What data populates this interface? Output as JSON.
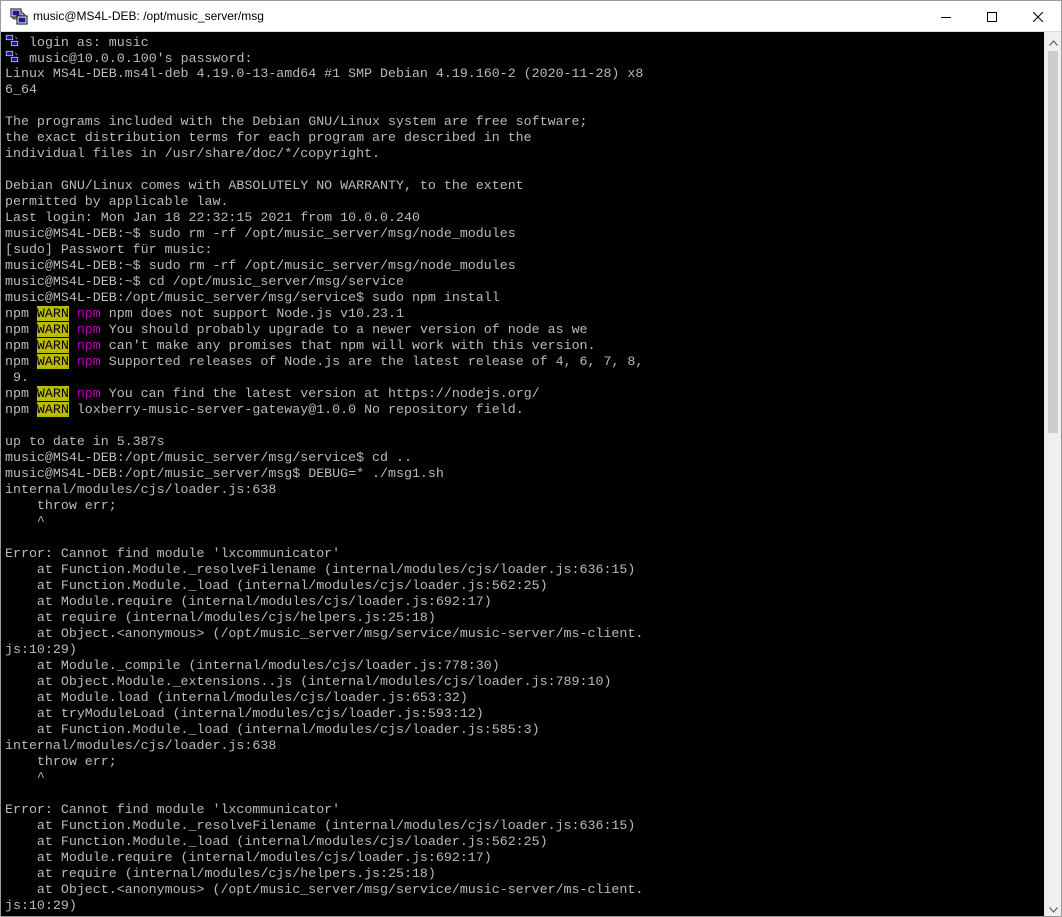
{
  "window": {
    "title": "music@MS4L-DEB: /opt/music_server/msg",
    "icons": {
      "app": "putty-icon",
      "minimize": "minimize-icon",
      "maximize": "maximize-icon",
      "close": "close-icon",
      "key": "key-icon"
    }
  },
  "colors": {
    "background": "#000000",
    "foreground": "#bbbbbb",
    "warn_bg": "#bbbb00",
    "npm_magenta": "#bb00bb"
  },
  "terminal": {
    "lines": [
      {
        "icon": "key",
        "segments": [
          {
            "text": "login as: music"
          }
        ]
      },
      {
        "icon": "key",
        "segments": [
          {
            "text": "music@10.0.0.100's password:"
          }
        ]
      },
      {
        "segments": [
          {
            "text": "Linux MS4L-DEB.ms4l-deb 4.19.0-13-amd64 #1 SMP Debian 4.19.160-2 (2020-11-28) x8"
          }
        ]
      },
      {
        "segments": [
          {
            "text": "6_64"
          }
        ]
      },
      {
        "segments": [
          {
            "text": ""
          }
        ]
      },
      {
        "segments": [
          {
            "text": "The programs included with the Debian GNU/Linux system are free software;"
          }
        ]
      },
      {
        "segments": [
          {
            "text": "the exact distribution terms for each program are described in the"
          }
        ]
      },
      {
        "segments": [
          {
            "text": "individual files in /usr/share/doc/*/copyright."
          }
        ]
      },
      {
        "segments": [
          {
            "text": ""
          }
        ]
      },
      {
        "segments": [
          {
            "text": "Debian GNU/Linux comes with ABSOLUTELY NO WARRANTY, to the extent"
          }
        ]
      },
      {
        "segments": [
          {
            "text": "permitted by applicable law."
          }
        ]
      },
      {
        "segments": [
          {
            "text": "Last login: Mon Jan 18 22:32:15 2021 from 10.0.0.240"
          }
        ]
      },
      {
        "segments": [
          {
            "text": "music@MS4L-DEB:~$ sudo rm -rf /opt/music_server/msg/node_modules"
          }
        ]
      },
      {
        "segments": [
          {
            "text": "[sudo] Passwort für music:"
          }
        ]
      },
      {
        "segments": [
          {
            "text": "music@MS4L-DEB:~$ sudo rm -rf /opt/music_server/msg/node_modules"
          }
        ]
      },
      {
        "segments": [
          {
            "text": "music@MS4L-DEB:~$ cd /opt/music_server/msg/service"
          }
        ]
      },
      {
        "segments": [
          {
            "text": "music@MS4L-DEB:/opt/music_server/msg/service$ sudo npm install"
          }
        ]
      },
      {
        "segments": [
          {
            "text": "npm "
          },
          {
            "text": "WARN",
            "style": "warn"
          },
          {
            "text": " "
          },
          {
            "text": "npm",
            "style": "npm"
          },
          {
            "text": " npm does not support Node.js v10.23.1"
          }
        ]
      },
      {
        "segments": [
          {
            "text": "npm "
          },
          {
            "text": "WARN",
            "style": "warn"
          },
          {
            "text": " "
          },
          {
            "text": "npm",
            "style": "npm"
          },
          {
            "text": " You should probably upgrade to a newer version of node as we"
          }
        ]
      },
      {
        "segments": [
          {
            "text": "npm "
          },
          {
            "text": "WARN",
            "style": "warn"
          },
          {
            "text": " "
          },
          {
            "text": "npm",
            "style": "npm"
          },
          {
            "text": " can't make any promises that npm will work with this version."
          }
        ]
      },
      {
        "segments": [
          {
            "text": "npm "
          },
          {
            "text": "WARN",
            "style": "warn"
          },
          {
            "text": " "
          },
          {
            "text": "npm",
            "style": "npm"
          },
          {
            "text": " Supported releases of Node.js are the latest release of 4, 6, 7, 8,"
          }
        ]
      },
      {
        "segments": [
          {
            "text": " 9."
          }
        ]
      },
      {
        "segments": [
          {
            "text": "npm "
          },
          {
            "text": "WARN",
            "style": "warn"
          },
          {
            "text": " "
          },
          {
            "text": "npm",
            "style": "npm"
          },
          {
            "text": " You can find the latest version at https://nodejs.org/"
          }
        ]
      },
      {
        "segments": [
          {
            "text": "npm "
          },
          {
            "text": "WARN",
            "style": "warn"
          },
          {
            "text": " loxberry-music-server-gateway@1.0.0 No repository field."
          }
        ]
      },
      {
        "segments": [
          {
            "text": ""
          }
        ]
      },
      {
        "segments": [
          {
            "text": "up to date in 5.387s"
          }
        ]
      },
      {
        "segments": [
          {
            "text": "music@MS4L-DEB:/opt/music_server/msg/service$ cd .."
          }
        ]
      },
      {
        "segments": [
          {
            "text": "music@MS4L-DEB:/opt/music_server/msg$ DEBUG=* ./msg1.sh"
          }
        ]
      },
      {
        "segments": [
          {
            "text": "internal/modules/cjs/loader.js:638"
          }
        ]
      },
      {
        "segments": [
          {
            "text": "    throw err;"
          }
        ]
      },
      {
        "segments": [
          {
            "text": "    ^"
          }
        ]
      },
      {
        "segments": [
          {
            "text": ""
          }
        ]
      },
      {
        "segments": [
          {
            "text": "Error: Cannot find module 'lxcommunicator'"
          }
        ]
      },
      {
        "segments": [
          {
            "text": "    at Function.Module._resolveFilename (internal/modules/cjs/loader.js:636:15)"
          }
        ]
      },
      {
        "segments": [
          {
            "text": "    at Function.Module._load (internal/modules/cjs/loader.js:562:25)"
          }
        ]
      },
      {
        "segments": [
          {
            "text": "    at Module.require (internal/modules/cjs/loader.js:692:17)"
          }
        ]
      },
      {
        "segments": [
          {
            "text": "    at require (internal/modules/cjs/helpers.js:25:18)"
          }
        ]
      },
      {
        "segments": [
          {
            "text": "    at Object.<anonymous> (/opt/music_server/msg/service/music-server/ms-client."
          }
        ]
      },
      {
        "segments": [
          {
            "text": "js:10:29)"
          }
        ]
      },
      {
        "segments": [
          {
            "text": "    at Module._compile (internal/modules/cjs/loader.js:778:30)"
          }
        ]
      },
      {
        "segments": [
          {
            "text": "    at Object.Module._extensions..js (internal/modules/cjs/loader.js:789:10)"
          }
        ]
      },
      {
        "segments": [
          {
            "text": "    at Module.load (internal/modules/cjs/loader.js:653:32)"
          }
        ]
      },
      {
        "segments": [
          {
            "text": "    at tryModuleLoad (internal/modules/cjs/loader.js:593:12)"
          }
        ]
      },
      {
        "segments": [
          {
            "text": "    at Function.Module._load (internal/modules/cjs/loader.js:585:3)"
          }
        ]
      },
      {
        "segments": [
          {
            "text": "internal/modules/cjs/loader.js:638"
          }
        ]
      },
      {
        "segments": [
          {
            "text": "    throw err;"
          }
        ]
      },
      {
        "segments": [
          {
            "text": "    ^"
          }
        ]
      },
      {
        "segments": [
          {
            "text": ""
          }
        ]
      },
      {
        "segments": [
          {
            "text": "Error: Cannot find module 'lxcommunicator'"
          }
        ]
      },
      {
        "segments": [
          {
            "text": "    at Function.Module._resolveFilename (internal/modules/cjs/loader.js:636:15)"
          }
        ]
      },
      {
        "segments": [
          {
            "text": "    at Function.Module._load (internal/modules/cjs/loader.js:562:25)"
          }
        ]
      },
      {
        "segments": [
          {
            "text": "    at Module.require (internal/modules/cjs/loader.js:692:17)"
          }
        ]
      },
      {
        "segments": [
          {
            "text": "    at require (internal/modules/cjs/helpers.js:25:18)"
          }
        ]
      },
      {
        "segments": [
          {
            "text": "    at Object.<anonymous> (/opt/music_server/msg/service/music-server/ms-client."
          }
        ]
      },
      {
        "segments": [
          {
            "text": "js:10:29)"
          }
        ]
      }
    ]
  }
}
